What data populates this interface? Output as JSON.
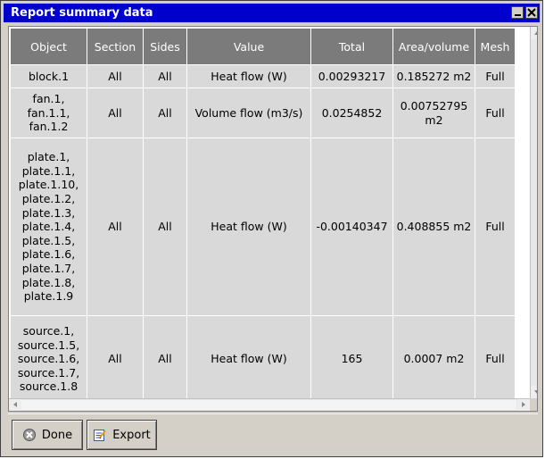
{
  "window": {
    "title": "Report summary data"
  },
  "table": {
    "headers": [
      "Object",
      "Section",
      "Sides",
      "Value",
      "Total",
      "Area/volume",
      "Mesh"
    ],
    "rows": [
      {
        "object": "block.1",
        "section": "All",
        "sides": "All",
        "value": "Heat flow (W)",
        "total": "0.00293217",
        "area": "0.185272 m2",
        "mesh": "Full"
      },
      {
        "object": "fan.1,\nfan.1.1,\nfan.1.2",
        "section": "All",
        "sides": "All",
        "value": "Volume flow (m3/s)",
        "total": "0.0254852",
        "area": "0.00752795 m2",
        "mesh": "Full"
      },
      {
        "object": "plate.1,\nplate.1.1,\nplate.1.10,\nplate.1.2,\nplate.1.3,\nplate.1.4,\nplate.1.5,\nplate.1.6,\nplate.1.7,\nplate.1.8,\nplate.1.9",
        "section": "All",
        "sides": "All",
        "value": "Heat flow (W)",
        "total": "-0.00140347",
        "area": "0.408855 m2",
        "mesh": "Full"
      },
      {
        "object": "source.1,\nsource.1.5,\nsource.1.6,\nsource.1.7,\nsource.1.8",
        "section": "All",
        "sides": "All",
        "value": "Heat flow (W)",
        "total": "165",
        "area": "0.0007 m2",
        "mesh": "Full"
      }
    ]
  },
  "buttons": {
    "done": "Done",
    "export": "Export"
  },
  "icons": {
    "done": "done-icon",
    "export": "export-icon",
    "minimize": "minimize-icon",
    "close": "close-icon"
  },
  "colors": {
    "titlebar": "#0000cc",
    "header": "#7b7b7b",
    "cell": "#d9d9d9",
    "panel": "#d4d0c8"
  }
}
